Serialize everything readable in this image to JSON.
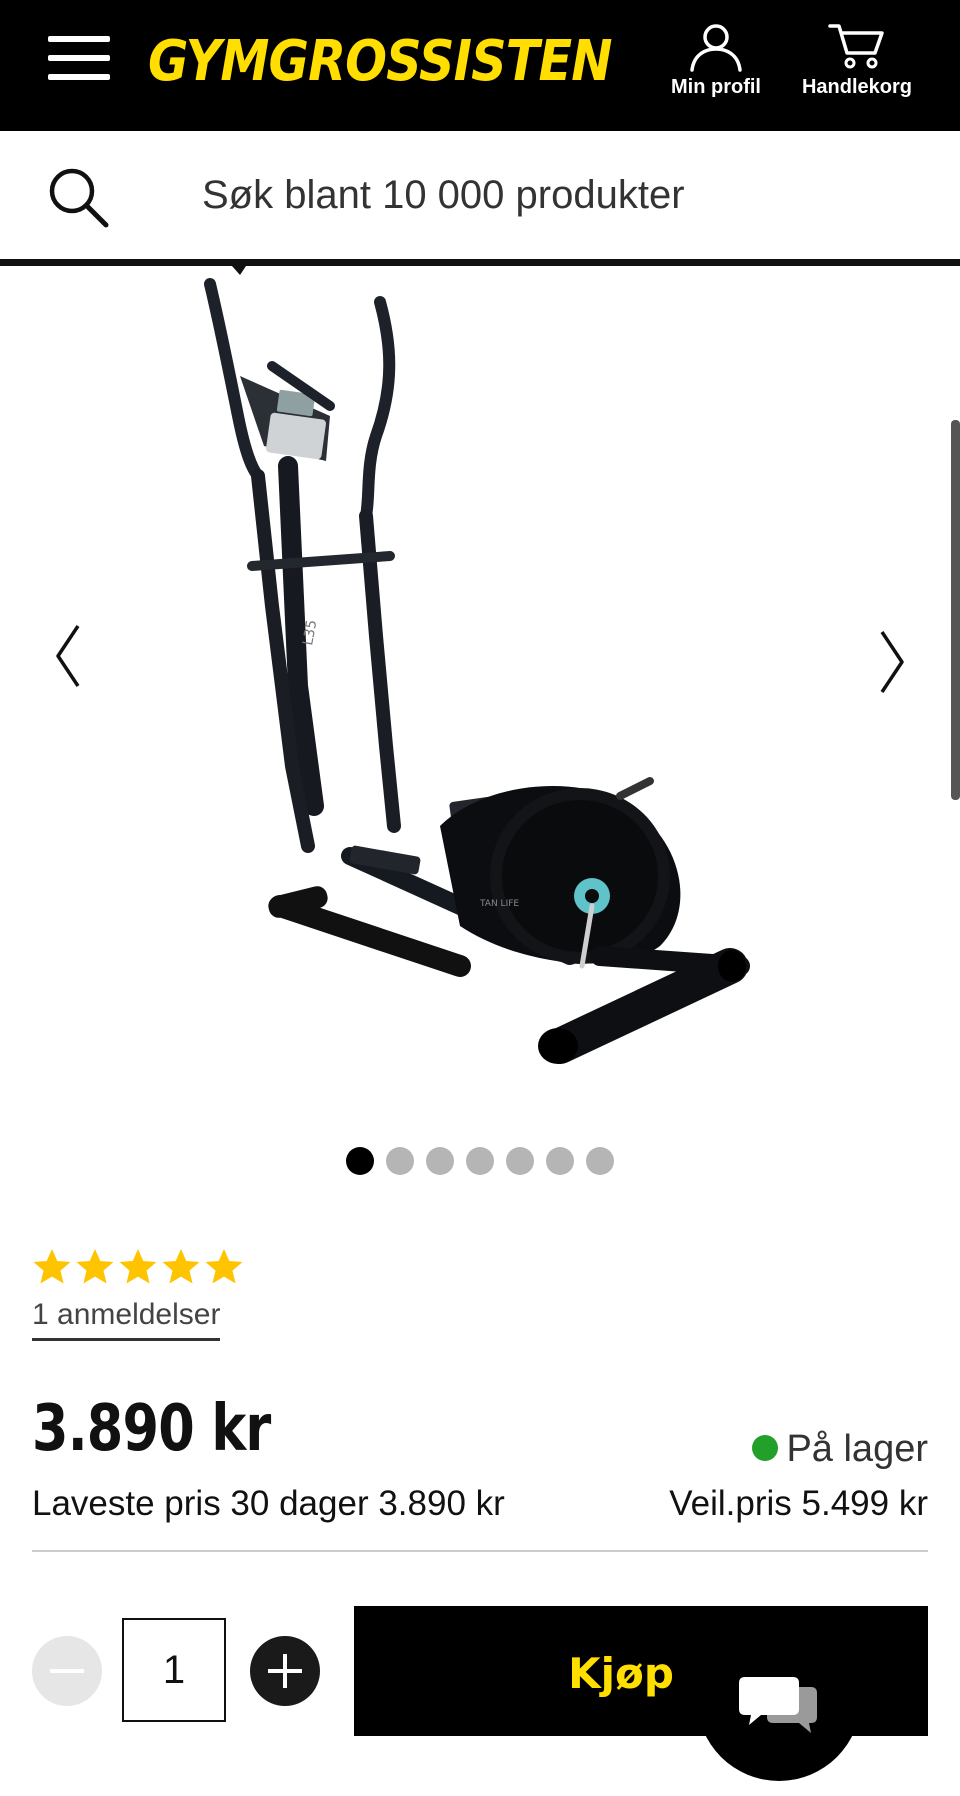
{
  "header": {
    "logo": "GYMGROSSISTEN",
    "profile_label": "Min profil",
    "cart_label": "Handlekorg",
    "background": "#000000",
    "brand_color": "#FFDE00"
  },
  "search": {
    "placeholder": "Søk blant 10 000 produkter"
  },
  "gallery": {
    "image_count": 7,
    "active_index": 0,
    "image_alt": "Crosstrainer / ellipsemaskin"
  },
  "rating": {
    "stars": 5,
    "reviews_label": "1 anmeldelser",
    "star_color": "#FFC400"
  },
  "pricing": {
    "price": "3.890 kr",
    "lowest_30_days": "Laveste pris 30 dager 3.890 kr",
    "recommended": "Veil.pris 5.499 kr",
    "stock_status": "På lager",
    "stock_color": "#22A02A"
  },
  "purchase": {
    "quantity": "1",
    "buy_label": "Kjøp"
  },
  "icons": [
    "menu-icon",
    "user-icon",
    "cart-icon",
    "search-icon",
    "chevron-left-icon",
    "chevron-right-icon",
    "star-icon",
    "minus-icon",
    "plus-icon",
    "chat-icon"
  ]
}
